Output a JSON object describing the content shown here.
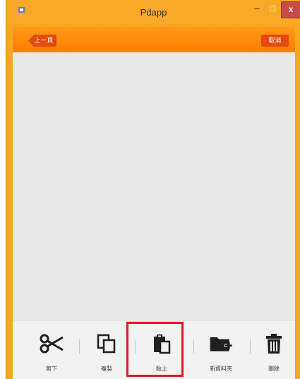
{
  "window": {
    "title": "Pdapp",
    "minimize_glyph": "–",
    "maximize_glyph": "□",
    "close_glyph": "x"
  },
  "appbar": {
    "back_label": "上一頁",
    "cancel_label": "取消"
  },
  "toolbar": {
    "items": [
      {
        "label": "剪下",
        "icon": "scissors-icon"
      },
      {
        "label": "複製",
        "icon": "copy-icon"
      },
      {
        "label": "貼上",
        "icon": "paste-icon",
        "highlighted": true
      },
      {
        "label": "新資料夾",
        "icon": "new-folder-icon"
      },
      {
        "label": "刪除",
        "icon": "trash-icon"
      }
    ]
  },
  "colors": {
    "accent": "#ff7d00",
    "button": "#e34a0c",
    "highlight": "#e0191f",
    "content_bg": "#e8e8e8"
  }
}
